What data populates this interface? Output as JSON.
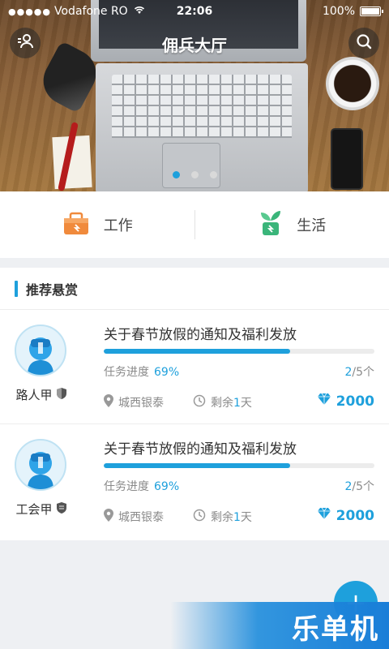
{
  "status_bar": {
    "signal": "●●●●●",
    "carrier": "Vodafone RO",
    "time": "22:06",
    "battery": "100%"
  },
  "header": {
    "title": "佣兵大厅",
    "left_icon": "user-profile-icon",
    "right_icon": "search-icon"
  },
  "banner": {
    "slides": 3,
    "active_slide": 1
  },
  "categories": [
    {
      "label": "工作",
      "icon": "work-toolbox-icon",
      "color": "#f08a3c"
    },
    {
      "label": "生活",
      "icon": "plant-sprout-icon",
      "color": "#3ab57a"
    }
  ],
  "section": {
    "title": "推荐悬赏"
  },
  "tasks": [
    {
      "user": "路人甲",
      "badge": "shield-badge-icon",
      "title": "关于春节放假的通知及福利发放",
      "progress_label": "任务进度",
      "progress_pct": "69%",
      "progress_value": 0.69,
      "slots_taken": "2",
      "slots_total": "/5个",
      "location": "城西银泰",
      "remain_prefix": "剩余",
      "remain_num": "1",
      "remain_suffix": "天",
      "reward": "2000"
    },
    {
      "user": "工会甲",
      "badge": "guild-shield-icon",
      "title": "关于春节放假的通知及福利发放",
      "progress_label": "任务进度",
      "progress_pct": "69%",
      "progress_value": 0.69,
      "slots_taken": "2",
      "slots_total": "/5个",
      "location": "城西银泰",
      "remain_prefix": "剩余",
      "remain_num": "1",
      "remain_suffix": "天",
      "reward": "2000"
    }
  ],
  "fab": {
    "label": "+"
  },
  "watermark": {
    "text": "乐单机"
  },
  "colors": {
    "accent": "#1ea0dc",
    "text": "#333333",
    "muted": "#8a8a8a"
  }
}
